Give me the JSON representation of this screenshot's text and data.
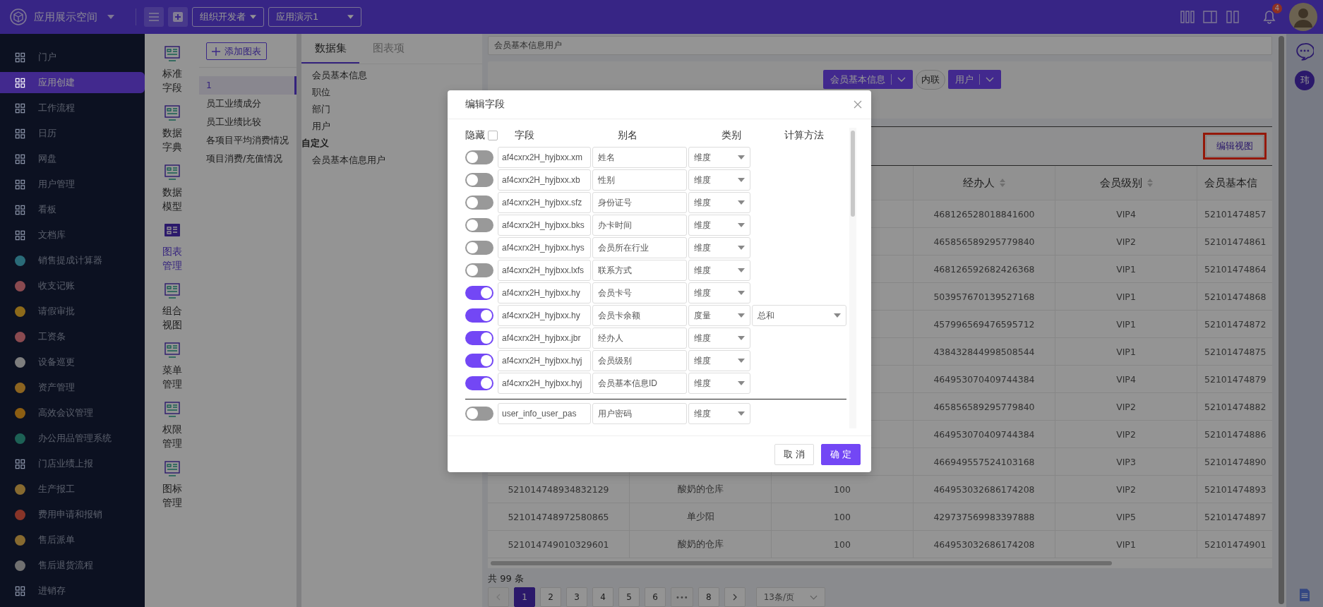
{
  "topbar": {
    "space_name": "应用展示空间",
    "org_dropdown": "组织开发者",
    "app_select": "应用演示1",
    "notification_count": "4"
  },
  "nav": [
    {
      "label": "门户",
      "kind": "line",
      "selected": false
    },
    {
      "label": "应用创建",
      "kind": "line",
      "selected": true
    },
    {
      "label": "工作流程",
      "kind": "line",
      "selected": false
    },
    {
      "label": "日历",
      "kind": "line",
      "selected": false
    },
    {
      "label": "网盘",
      "kind": "line",
      "selected": false
    },
    {
      "label": "用户管理",
      "kind": "line",
      "selected": false
    },
    {
      "label": "看板",
      "kind": "line",
      "selected": false
    },
    {
      "label": "文档库",
      "kind": "line",
      "selected": false
    },
    {
      "label": "销售提成计算器",
      "kind": "app",
      "color": "#2a6b78",
      "selected": false
    },
    {
      "label": "收支记账",
      "kind": "app",
      "color": "#8a4a50",
      "selected": false
    },
    {
      "label": "请假审批",
      "kind": "app",
      "color": "#8d6a1a",
      "selected": false
    },
    {
      "label": "工资条",
      "kind": "app",
      "color": "#8a4a50",
      "selected": false
    },
    {
      "label": "设备巡更",
      "kind": "app",
      "color": "#7e7e7e",
      "selected": false
    },
    {
      "label": "资产管理",
      "kind": "app",
      "color": "#8c6420",
      "selected": false
    },
    {
      "label": "高效会议管理",
      "kind": "app",
      "color": "#8c5e12",
      "selected": false
    },
    {
      "label": "办公用品管理系统",
      "kind": "app",
      "color": "#1d6155",
      "selected": false
    },
    {
      "label": "门店业绩上报",
      "kind": "line",
      "selected": false
    },
    {
      "label": "生产报工",
      "kind": "app",
      "color": "#876a30",
      "selected": false
    },
    {
      "label": "费用申请和报销",
      "kind": "app",
      "color": "#883428",
      "selected": false
    },
    {
      "label": "售后派单",
      "kind": "app",
      "color": "#876a30",
      "selected": false
    },
    {
      "label": "售后退货流程",
      "kind": "app",
      "color": "#707070",
      "selected": false
    },
    {
      "label": "进销存",
      "kind": "line",
      "selected": false
    }
  ],
  "tool_menu": [
    {
      "label": "标准字段",
      "selected": false
    },
    {
      "label": "数据字典",
      "selected": false
    },
    {
      "label": "数据模型",
      "selected": false
    },
    {
      "label": "图表管理",
      "selected": true
    },
    {
      "label": "组合视图",
      "selected": false
    },
    {
      "label": "菜单管理",
      "selected": false
    },
    {
      "label": "权限管理",
      "selected": false
    },
    {
      "label": "图标管理",
      "selected": false
    }
  ],
  "chart_list": {
    "add_button": "添加图表",
    "items": [
      {
        "label": "1",
        "selected": true
      },
      {
        "label": "员工业绩成分",
        "selected": false
      },
      {
        "label": "员工业绩比较",
        "selected": false
      },
      {
        "label": "各项目平均消费情况",
        "selected": false
      },
      {
        "label": "项目消费/充值情况",
        "selected": false
      }
    ]
  },
  "data_panel": {
    "tabs": [
      {
        "label": "数据集",
        "selected": true
      },
      {
        "label": "图表项",
        "selected": false
      }
    ],
    "groups": [
      {
        "items": [
          "会员基本信息",
          "职位",
          "部门",
          "用户"
        ]
      },
      {
        "title": "自定义",
        "items": [
          "会员基本信息用户"
        ]
      }
    ]
  },
  "main": {
    "dataset_name": "会员基本信息用户",
    "join": {
      "left": "会员基本信息",
      "type": "内联",
      "right": "用户"
    },
    "edit_view_button": "编辑视图",
    "table": {
      "columns": [
        {
          "label": "经办人",
          "sortable": true
        },
        {
          "label": "会员级别",
          "sortable": true
        },
        {
          "label": "会员基本信",
          "sortable": false
        }
      ],
      "rows": [
        {
          "cells": [
            "468126528018841600",
            "VIP4",
            "52101474857"
          ]
        },
        {
          "cells": [
            "465856589295779840",
            "VIP2",
            "52101474861"
          ]
        },
        {
          "cells": [
            "468126592682426368",
            "VIP1",
            "52101474864"
          ]
        },
        {
          "cells": [
            "503957670139527168",
            "VIP1",
            "52101474868"
          ]
        },
        {
          "cells": [
            "457996569476595712",
            "VIP1",
            "52101474872"
          ]
        },
        {
          "cells": [
            "438432844998508544",
            "VIP1",
            "52101474875"
          ]
        },
        {
          "cells": [
            "464953070409744384",
            "VIP4",
            "52101474879"
          ]
        },
        {
          "cells": [
            "465856589295779840",
            "VIP2",
            "52101474882"
          ]
        },
        {
          "cells": [
            "464953070409744384",
            "VIP2",
            "52101474886"
          ]
        },
        {
          "cells": [
            "466949557524103168",
            "VIP3",
            "52101474890"
          ]
        },
        {
          "cells": [
            "521014748934832129",
            "酸奶的仓库",
            "100",
            "464953032686174208",
            "VIP2",
            "52101474893"
          ]
        },
        {
          "cells": [
            "521014748972580865",
            "单少阳",
            "100",
            "429737569983397888",
            "VIP5",
            "52101474897"
          ]
        },
        {
          "cells": [
            "521014749010329601",
            "酸奶的仓库",
            "100",
            "464953032686174208",
            "VIP1",
            "52101474901"
          ]
        }
      ]
    },
    "total": "共 99 条",
    "pages": [
      {
        "label": "1",
        "kind": "page",
        "selected": true
      },
      {
        "label": "2",
        "kind": "page",
        "selected": false
      },
      {
        "label": "3",
        "kind": "page",
        "selected": false
      },
      {
        "label": "4",
        "kind": "page",
        "selected": false
      },
      {
        "label": "5",
        "kind": "page",
        "selected": false
      },
      {
        "label": "6",
        "kind": "page",
        "selected": false
      },
      {
        "label": "•••",
        "kind": "more",
        "selected": false
      },
      {
        "label": "8",
        "kind": "page",
        "selected": false
      }
    ],
    "page_size": "13条/页"
  },
  "right_rail": {
    "avatar_initial": "玮"
  },
  "modal": {
    "title": "编辑字段",
    "hide_label": "隐藏",
    "hide_all_checked": false,
    "columns": [
      "字段",
      "别名",
      "类别",
      "计算方法"
    ],
    "groups": [
      {
        "rows": [
          {
            "on": false,
            "field": "af4cxrx2H_hyjbxx.xm",
            "alias": "姓名",
            "category": "维度"
          },
          {
            "on": false,
            "field": "af4cxrx2H_hyjbxx.xb",
            "alias": "性别",
            "category": "维度"
          },
          {
            "on": false,
            "field": "af4cxrx2H_hyjbxx.sfz",
            "alias": "身份证号",
            "category": "维度"
          },
          {
            "on": false,
            "field": "af4cxrx2H_hyjbxx.bks",
            "alias": "办卡时间",
            "category": "维度"
          },
          {
            "on": false,
            "field": "af4cxrx2H_hyjbxx.hys",
            "alias": "会员所在行业",
            "category": "维度"
          },
          {
            "on": false,
            "field": "af4cxrx2H_hyjbxx.lxfs",
            "alias": "联系方式",
            "category": "维度"
          },
          {
            "on": true,
            "field": "af4cxrx2H_hyjbxx.hy",
            "alias": "会员卡号",
            "category": "维度"
          },
          {
            "on": true,
            "field": "af4cxrx2H_hyjbxx.hy",
            "alias": "会员卡余额",
            "category": "度量",
            "method": "总和"
          },
          {
            "on": true,
            "field": "af4cxrx2H_hyjbxx.jbr",
            "alias": "经办人",
            "category": "维度"
          },
          {
            "on": true,
            "field": "af4cxrx2H_hyjbxx.hyj",
            "alias": "会员级别",
            "category": "维度"
          },
          {
            "on": true,
            "field": "af4cxrx2H_hyjbxx.hyj",
            "alias": "会员基本信息ID",
            "category": "维度"
          }
        ]
      },
      {
        "rows": [
          {
            "on": false,
            "field": "user_info_user_pas",
            "alias": "用户密码",
            "category": "维度"
          }
        ]
      }
    ],
    "cancel": "取 消",
    "ok": "确 定"
  }
}
